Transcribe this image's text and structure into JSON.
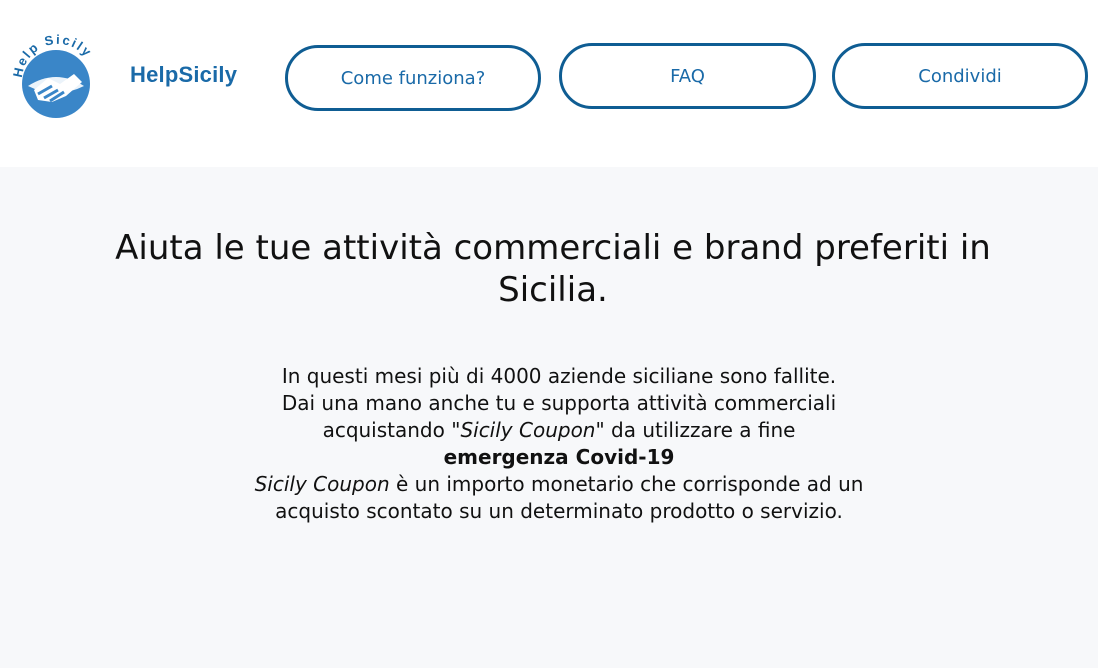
{
  "brand": {
    "name": "HelpSicily",
    "logo_text": "Help Sicily",
    "color": "#1a6aa8"
  },
  "nav": {
    "how_label": "Come funziona?",
    "faq_label": "FAQ",
    "share_label": "Condividi"
  },
  "hero": {
    "title": "Aiuta le tue attività commerciali e brand preferiti in Sicilia.",
    "line1": "In questi mesi più di 4000 aziende siciliane sono fallite.",
    "line2": "Dai una mano anche tu e supporta attività commerciali acquistando \"",
    "coupon_italic": "Sicily Coupon",
    "line2_end": "\"  da utilizzare a fine",
    "emergency": "emergenza Covid-19",
    "coupon_italic_2": "Sicily Coupon",
    "line3": " è un importo monetario che corrisponde ad un acquisto scontato su un determinato prodotto o servizio."
  },
  "colors": {
    "accent": "#1a6aa8",
    "button_border": "#0f5d93",
    "hero_bg": "#f7f8fa"
  }
}
